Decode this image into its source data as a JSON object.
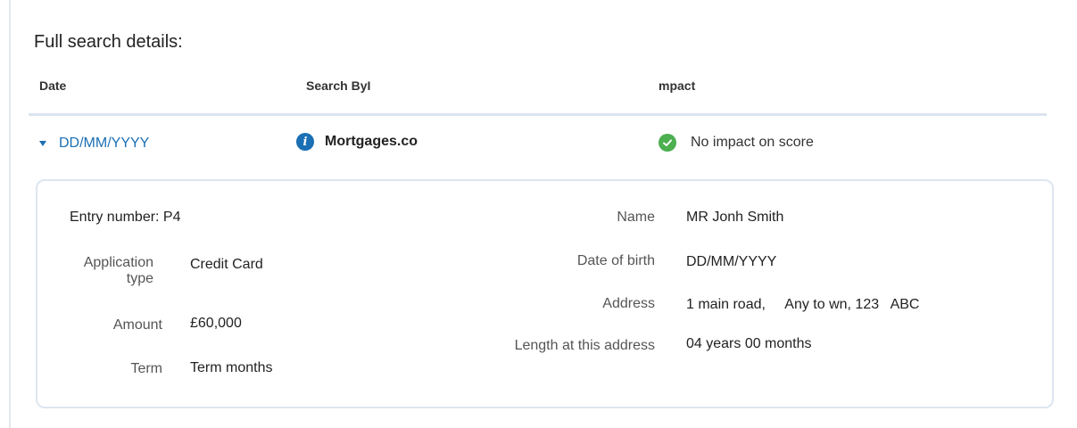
{
  "section_title": "Full search details:",
  "table": {
    "headers": {
      "date": "Date",
      "search_by": "Search ByI",
      "impact": "mpact"
    },
    "row": {
      "date": "DD/MM/YYYY",
      "search_by": "Mortgages.co",
      "impact": "No impact on score",
      "icons": {
        "expand": "caret-down-icon",
        "info": "info-icon",
        "impact": "check-circle-icon"
      }
    }
  },
  "details": {
    "entry_number": "Entry number: P4",
    "application_type_label": "Application type",
    "application_type_value": "Credit Card",
    "amount_label": "Amount",
    "amount_value": "£60,000",
    "term_label": "Term",
    "term_value": "Term months",
    "name_label": "Name",
    "name_value": "MR Jonh Smith",
    "dob_label": "Date of birth",
    "dob_value": "DD/MM/YYYY",
    "address_label": "Address",
    "address_value": "1 main road,     Any to wn, 123   ABC",
    "length_label": "Length at this address",
    "length_value": "04 years 00 months"
  },
  "colors": {
    "link": "#1b6fb4",
    "success": "#4caf50",
    "border": "#dde6ef"
  }
}
